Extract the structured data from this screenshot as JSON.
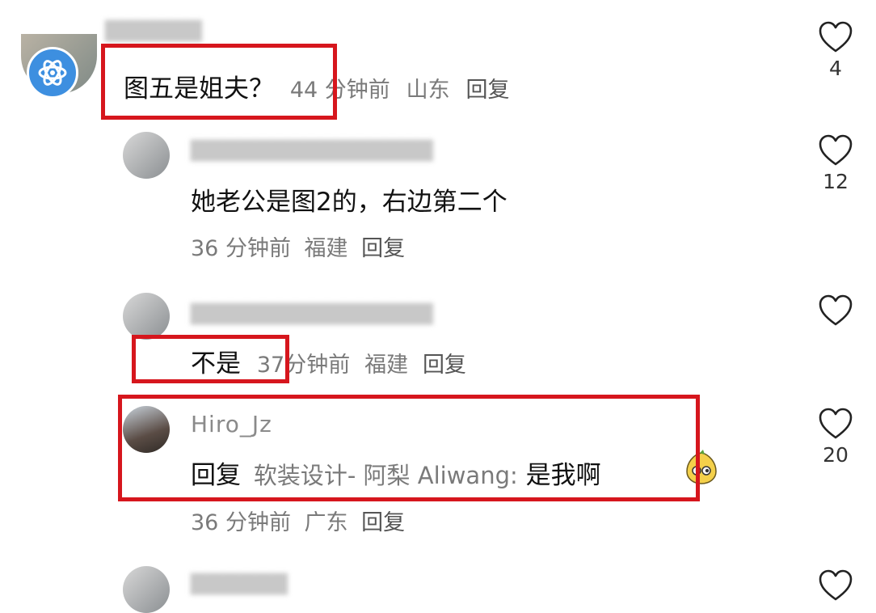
{
  "comments": [
    {
      "text": "图五是姐夫？",
      "time": "44 分钟前",
      "location": "山东",
      "reply": "回复",
      "likes": "4"
    },
    {
      "text": "她老公是图2的，右边第二个",
      "time": "36 分钟前",
      "location": "福建",
      "reply": "回复",
      "likes": "12"
    },
    {
      "text": "不是",
      "time": "37分钟前",
      "location": "福建",
      "reply": "回复",
      "likes": ""
    },
    {
      "username": "Hiro_Jz",
      "reply_prefix": "回复",
      "reply_to": "软装设计- 阿梨 Aliwang:",
      "text": "是我啊",
      "time": "36 分钟前",
      "location": "广东",
      "reply": "回复",
      "likes": "20"
    }
  ],
  "colors": {
    "highlight_box": "#d6161d",
    "meta_text": "#7a7a7a"
  },
  "icons": [
    "heart-outline-icon",
    "atom-badge-icon",
    "emoji-sticker-icon"
  ]
}
